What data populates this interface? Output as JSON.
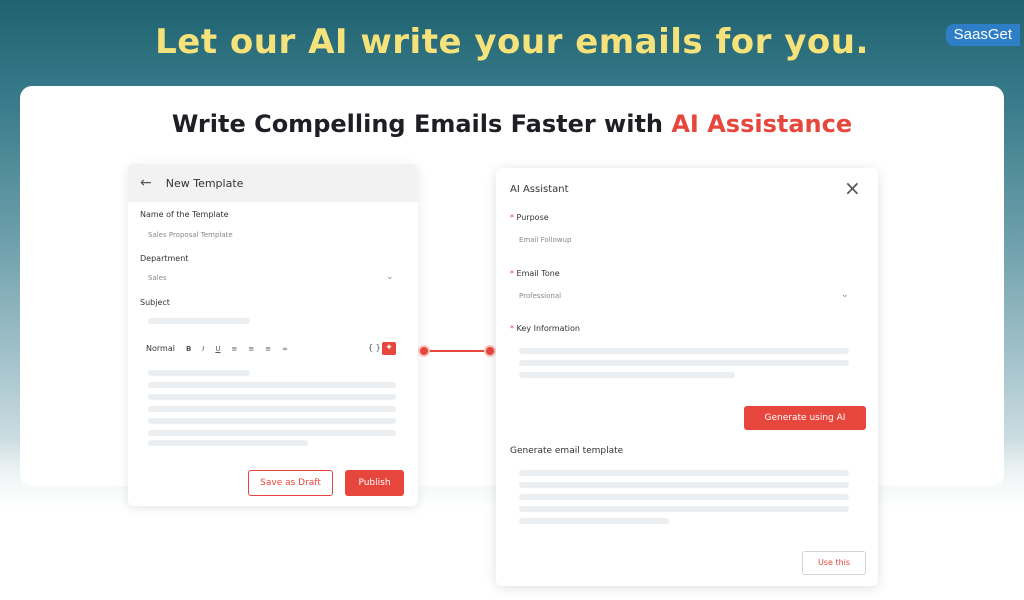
{
  "banner": {
    "headline": "Let our AI write your emails for you.",
    "brand": "SaasGet"
  },
  "card": {
    "subhead_main": "Write Compelling Emails Faster with ",
    "subhead_accent": "AI Assistance"
  },
  "colors": {
    "accent": "#e6463c",
    "headline": "#f6e27a",
    "brand_badge": "#2f7fc8"
  },
  "template_panel": {
    "title": "New Template",
    "name_label": "Name of the Template",
    "name_value": "Sales Proposal Template",
    "department_label": "Department",
    "department_value": "Sales",
    "subject_label": "Subject",
    "toolbar": {
      "style": "Normal",
      "bold": "B",
      "italic": "I",
      "underline": "U",
      "code": "{ }"
    },
    "save_draft_label": "Save as Draft",
    "publish_label": "Publish"
  },
  "assistant_panel": {
    "title": "AI Assistant",
    "purpose_label": "Purpose",
    "purpose_value": "Email Followup",
    "tone_label": "Email Tone",
    "tone_value": "Professional",
    "key_info_label": "Key Information",
    "required_mark": "*",
    "generate_label": "Generate using AI",
    "generated_label": "Generate email template",
    "use_label": "Use this"
  }
}
